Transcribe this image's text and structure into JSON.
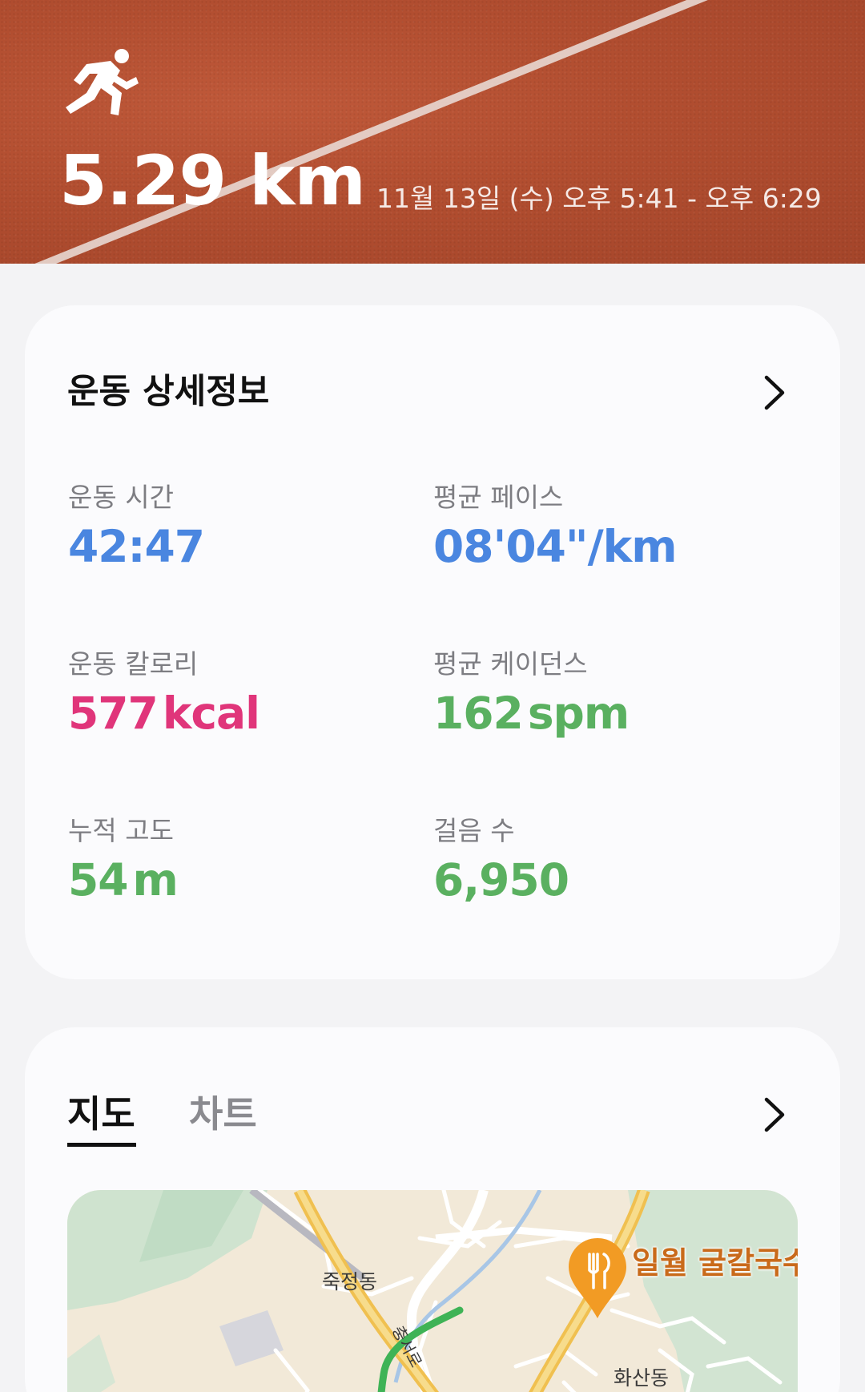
{
  "hero": {
    "activity_icon": "running-person-icon",
    "distance": "5.29 km",
    "date_range": "11월 13일 (수) 오후 5:41 - 오후 6:29"
  },
  "details": {
    "title": "운동 상세정보",
    "chevron_icon": "chevron-right-icon",
    "metrics": [
      {
        "label": "운동 시간",
        "value": "42:47",
        "unit": "",
        "color": "#4a86e0"
      },
      {
        "label": "평균 페이스",
        "value": "08'04\"",
        "unit": "/km",
        "color": "#4a86e0"
      },
      {
        "label": "운동 칼로리",
        "value": "577",
        "unit": "kcal",
        "color": "#e0357a"
      },
      {
        "label": "평균 케이던스",
        "value": "162",
        "unit": "spm",
        "color": "#5ab060"
      },
      {
        "label": "누적 고도",
        "value": "54",
        "unit": "m",
        "color": "#5ab060"
      },
      {
        "label": "걸음 수",
        "value": "6,950",
        "unit": "",
        "color": "#5ab060"
      }
    ]
  },
  "map_card": {
    "tabs": [
      {
        "label": "지도",
        "active": true
      },
      {
        "label": "차트",
        "active": false
      }
    ],
    "chevron_icon": "chevron-right-icon",
    "map": {
      "labels": [
        "죽정동",
        "화산동",
        "충서로"
      ],
      "place_name": "일월 굴칼국수",
      "place_icon": "restaurant-pin-icon"
    }
  }
}
